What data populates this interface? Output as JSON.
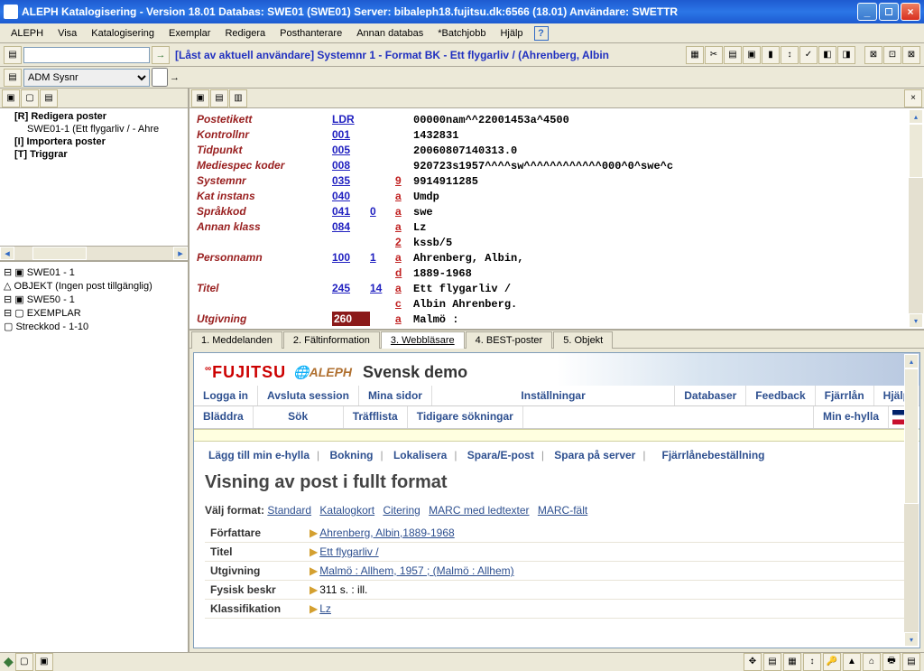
{
  "titlebar": "ALEPH Katalogisering - Version 18.01  Databas:   SWE01 (SWE01)  Server:   bibaleph18.fujitsu.dk:6566 (18.01)  Användare:  SWETTR",
  "menu": [
    "ALEPH",
    "Visa",
    "Katalogisering",
    "Exemplar",
    "Redigera",
    "Posthanterare",
    "Annan databas",
    "*Batchjobb",
    "Hjälp"
  ],
  "toolbar1": {
    "status": "[Låst av aktuell användare] Systemnr 1 - Format BK - Ett flygarliv / (Ahrenberg, Albin"
  },
  "toolbar2": {
    "select": "ADM Sysnr"
  },
  "tree_top": {
    "root": "[R] Redigera poster",
    "item1": "SWE01-1 (Ett flygarliv / - Ahre",
    "item2": "[I] Importera poster",
    "item3": "[T] Triggrar"
  },
  "tree_bot": {
    "n0": "SWE01 - 1",
    "n1": "OBJEKT (Ingen post tillgänglig)",
    "n2": "SWE50 - 1",
    "n3": "EXEMPLAR",
    "n4": "Streckkod - 1-10"
  },
  "marc": [
    {
      "label": "Postetikett",
      "tag": "LDR",
      "ind": "",
      "sub": "",
      "val": "00000nam^^22001453a^4500"
    },
    {
      "label": "Kontrollnr",
      "tag": "001",
      "ind": "",
      "sub": "",
      "val": "1432831"
    },
    {
      "label": "Tidpunkt",
      "tag": "005",
      "ind": "",
      "sub": "",
      "val": "20060807140313.0"
    },
    {
      "label": "Mediespec koder",
      "tag": "008",
      "ind": "",
      "sub": "",
      "val": "920723s1957^^^^sw^^^^^^^^^^^^000^0^swe^c"
    },
    {
      "label": "Systemnr",
      "tag": "035",
      "ind": "",
      "sub": "9",
      "val": "9914911285"
    },
    {
      "label": "Kat instans",
      "tag": "040",
      "ind": "",
      "sub": "a",
      "val": "Umdp"
    },
    {
      "label": "Språkkod",
      "tag": "041",
      "ind": "0",
      "sub": "a",
      "val": "swe"
    },
    {
      "label": "Annan klass",
      "tag": "084",
      "ind": "",
      "sub": "a",
      "val": "Lz"
    },
    {
      "label": "",
      "tag": "",
      "ind": "",
      "sub": "2",
      "val": "kssb/5"
    },
    {
      "label": "Personnamn",
      "tag": "100",
      "ind": "1",
      "sub": "a",
      "val": "Ahrenberg, Albin,"
    },
    {
      "label": "",
      "tag": "",
      "ind": "",
      "sub": "d",
      "val": "1889-1968"
    },
    {
      "label": "Titel",
      "tag": "245",
      "ind": "14",
      "sub": "a",
      "val": "Ett flygarliv /"
    },
    {
      "label": "",
      "tag": "",
      "ind": "",
      "sub": "c",
      "val": "Albin Ahrenberg."
    },
    {
      "label": "Utgivning",
      "tag": "260",
      "ind": "",
      "sub": "a",
      "val": "Malmö :",
      "sel": true
    }
  ],
  "tabs": [
    "1. Meddelanden",
    "2. Fältinformation",
    "3. Webbläsare",
    "4. BEST-poster",
    "5. Objekt"
  ],
  "active_tab": 2,
  "web": {
    "brand1": "FUJITSU",
    "brand2": "ALEPH",
    "demo": "Svensk demo",
    "nav1": [
      "Logga in",
      "Avsluta session",
      "Mina sidor",
      "Inställningar",
      "Databaser",
      "Feedback",
      "Fjärrlån",
      "Hjälp"
    ],
    "nav2": [
      "Bläddra",
      "Sök",
      "Träfflista",
      "Tidigare sökningar",
      "",
      "Min e-hylla"
    ],
    "actions": [
      "Lägg till min e-hylla",
      "Bokning",
      "Lokalisera",
      "Spara/E-post",
      "Spara på server",
      "Fjärrlånebeställning"
    ],
    "heading": "Visning av post i fullt format",
    "format_label": "Välj format:",
    "formats": [
      "Standard",
      "Katalogkort",
      "Citering",
      "MARC med ledtexter",
      "MARC-fält"
    ],
    "rows": [
      {
        "l": "Författare",
        "v": "Ahrenberg, Albin,1889-1968",
        "link": true
      },
      {
        "l": "Titel",
        "v": "Ett flygarliv /",
        "link": true
      },
      {
        "l": "Utgivning",
        "v": "Malmö : Allhem, 1957 ; (Malmö : Allhem)",
        "link": true
      },
      {
        "l": "Fysisk beskr",
        "v": "311 s. :  ill.",
        "link": false
      },
      {
        "l": "Klassifikation",
        "v": "Lz",
        "link": true
      }
    ]
  }
}
